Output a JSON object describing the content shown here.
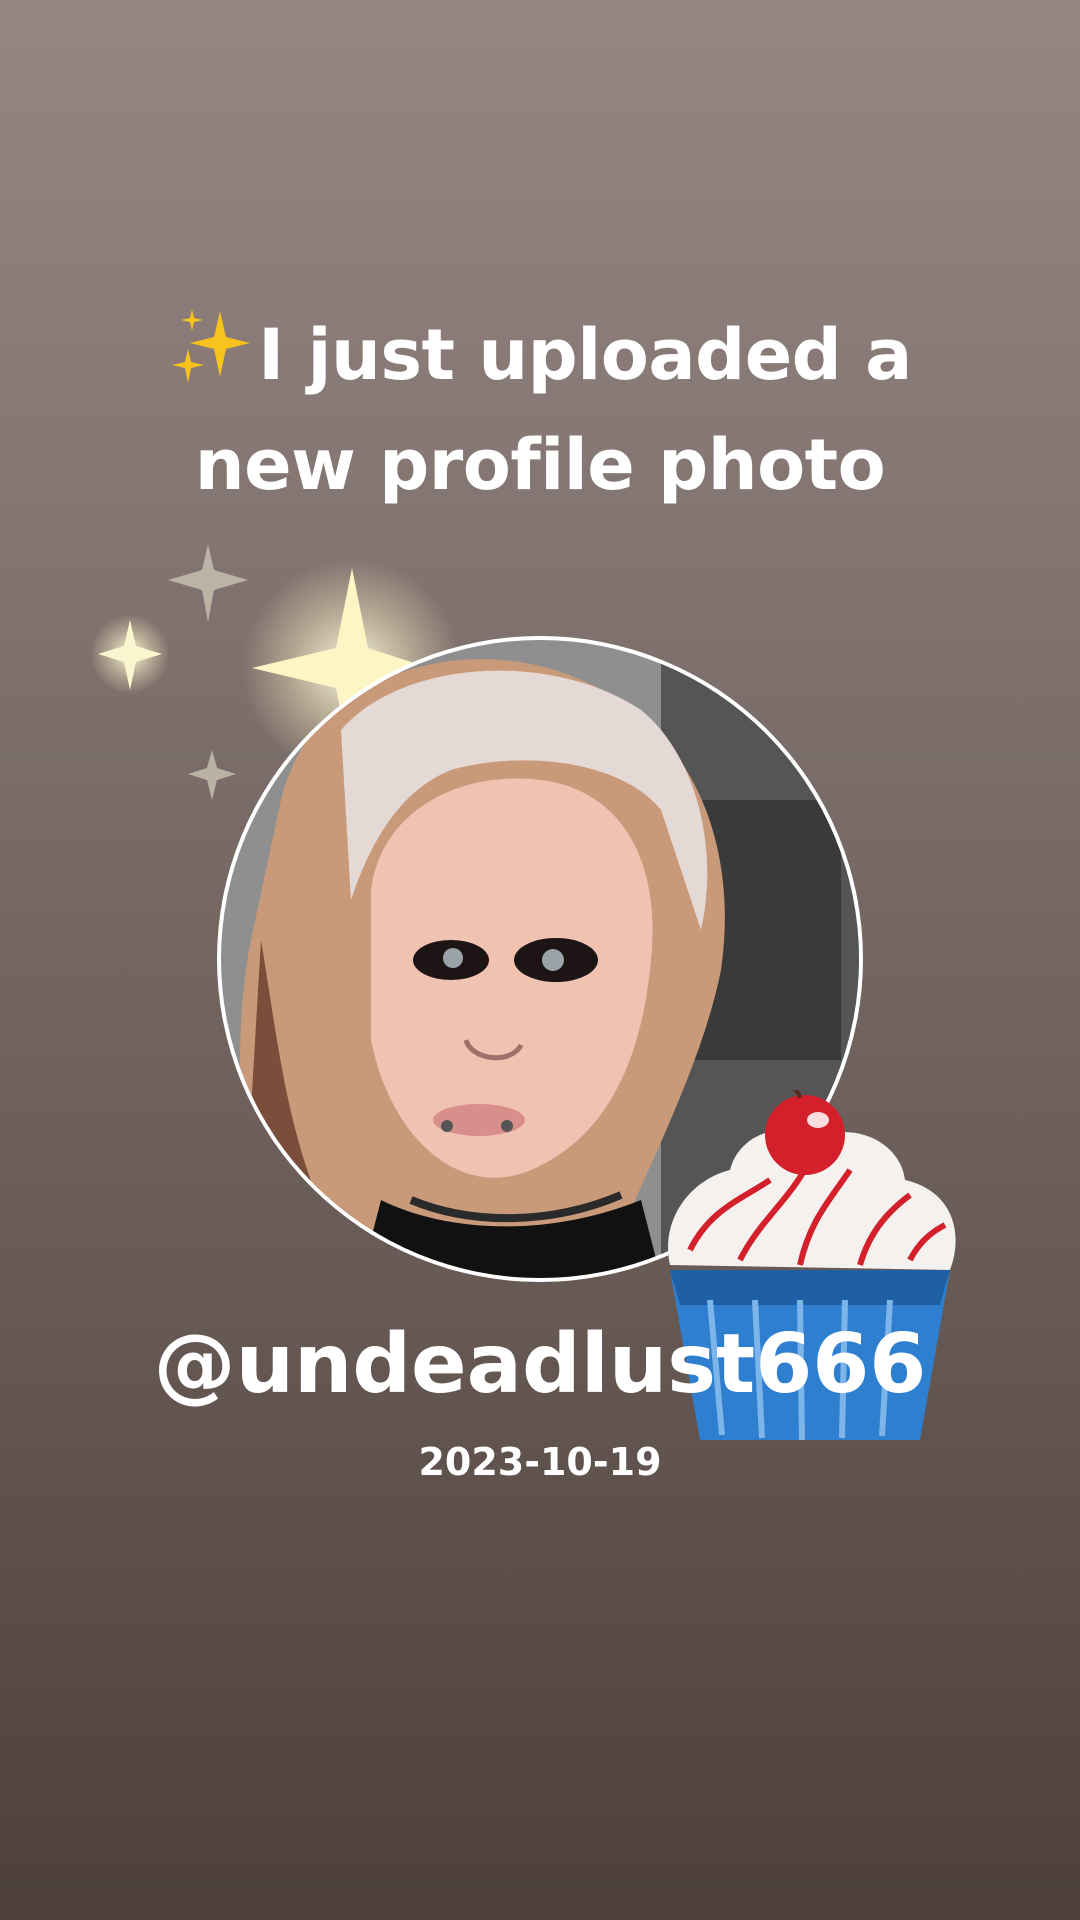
{
  "headline": {
    "emoji_icon": "sparkles-emoji-icon",
    "line1": "I just uploaded a",
    "line2": "new profile photo"
  },
  "profile": {
    "username": "@undeadlust666",
    "date": "2023-10-19"
  },
  "decorations": {
    "sparkle_group_icon": "glowing-sparkles-icon",
    "sticker_icon": "cupcake-cherry-icon"
  },
  "colors": {
    "background_top": "#968683",
    "background_bottom": "#4d403b",
    "text": "#ffffff",
    "ring": "#ffffff",
    "cupcake_wrapper": "#2f7fd0",
    "cherry": "#d3202a"
  }
}
